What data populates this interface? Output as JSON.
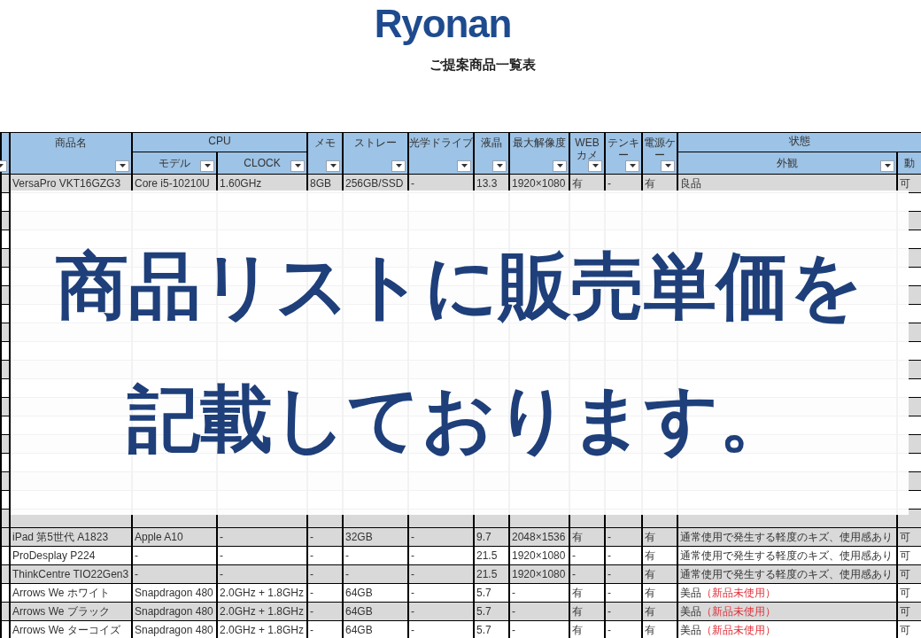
{
  "logo": "Ryonan",
  "subtitle": "ご提案商品一覧表",
  "table": {
    "columns": [
      {
        "label": "商品名"
      },
      {
        "group": "CPU",
        "children": [
          {
            "label": "モデル"
          },
          {
            "label": "CLOCK"
          }
        ]
      },
      {
        "label": "メモ"
      },
      {
        "label": "ストレー"
      },
      {
        "label": "光学ドライブ"
      },
      {
        "label": "液晶"
      },
      {
        "label": "最大解像度"
      },
      {
        "label": "WEB カメ"
      },
      {
        "label": "テンキー"
      },
      {
        "label": "電源ケー"
      },
      {
        "group": "状態",
        "children": [
          {
            "label": "外観"
          },
          {
            "label": "動"
          }
        ]
      }
    ],
    "rows_top": [
      {
        "shaded": true,
        "cells": [
          "VersaPro VKT16GZG3",
          "Core i5-10210U",
          "1.60GHz",
          "8GB",
          "256GB/SSD",
          "-",
          "13.3",
          "1920×1080",
          "有",
          "-",
          "有",
          "良品",
          "可"
        ]
      }
    ],
    "rows_bottom": [
      {
        "shaded": true,
        "cells": [
          "iPad 第5世代 A1823",
          "Apple A10",
          "-",
          "-",
          "32GB",
          "-",
          "9.7",
          "2048×1536",
          "有",
          "-",
          "有",
          "通常使用で発生する軽度のキズ、使用感あり",
          "可"
        ]
      },
      {
        "shaded": false,
        "cells": [
          "ProDesplay P224",
          "-",
          "-",
          "-",
          "-",
          "-",
          "21.5",
          "1920×1080",
          "-",
          "-",
          "有",
          "通常使用で発生する軽度のキズ、使用感あり",
          "可"
        ]
      },
      {
        "shaded": true,
        "cells": [
          "ThinkCentre TIO22Gen3",
          "-",
          "-",
          "-",
          "-",
          "-",
          "21.5",
          "1920×1080",
          "-",
          "-",
          "有",
          "通常使用で発生する軽度のキズ、使用感あり",
          "可"
        ]
      },
      {
        "shaded": false,
        "note": "（新品未使用）",
        "cells": [
          "Arrows We ホワイト",
          "Snapdragon 480",
          "2.0GHz + 1.8GHz",
          "-",
          "64GB",
          "-",
          "5.7",
          "-",
          "有",
          "-",
          "有",
          "美品",
          "可"
        ]
      },
      {
        "shaded": true,
        "note": "（新品未使用）",
        "cells": [
          "Arrows We ブラック",
          "Snapdragon 480",
          "2.0GHz + 1.8GHz",
          "-",
          "64GB",
          "-",
          "5.7",
          "-",
          "有",
          "-",
          "有",
          "美品",
          "可"
        ]
      },
      {
        "shaded": false,
        "note": "（新品未使用）",
        "cells": [
          "Arrows We ターコイズ",
          "Snapdragon 480",
          "2.0GHz + 1.8GHz",
          "-",
          "64GB",
          "-",
          "5.7",
          "-",
          "有",
          "-",
          "有",
          "美品",
          "可"
        ]
      }
    ]
  },
  "banner": {
    "lines": [
      "商品リストに販売単価を",
      "記載しております。"
    ]
  }
}
